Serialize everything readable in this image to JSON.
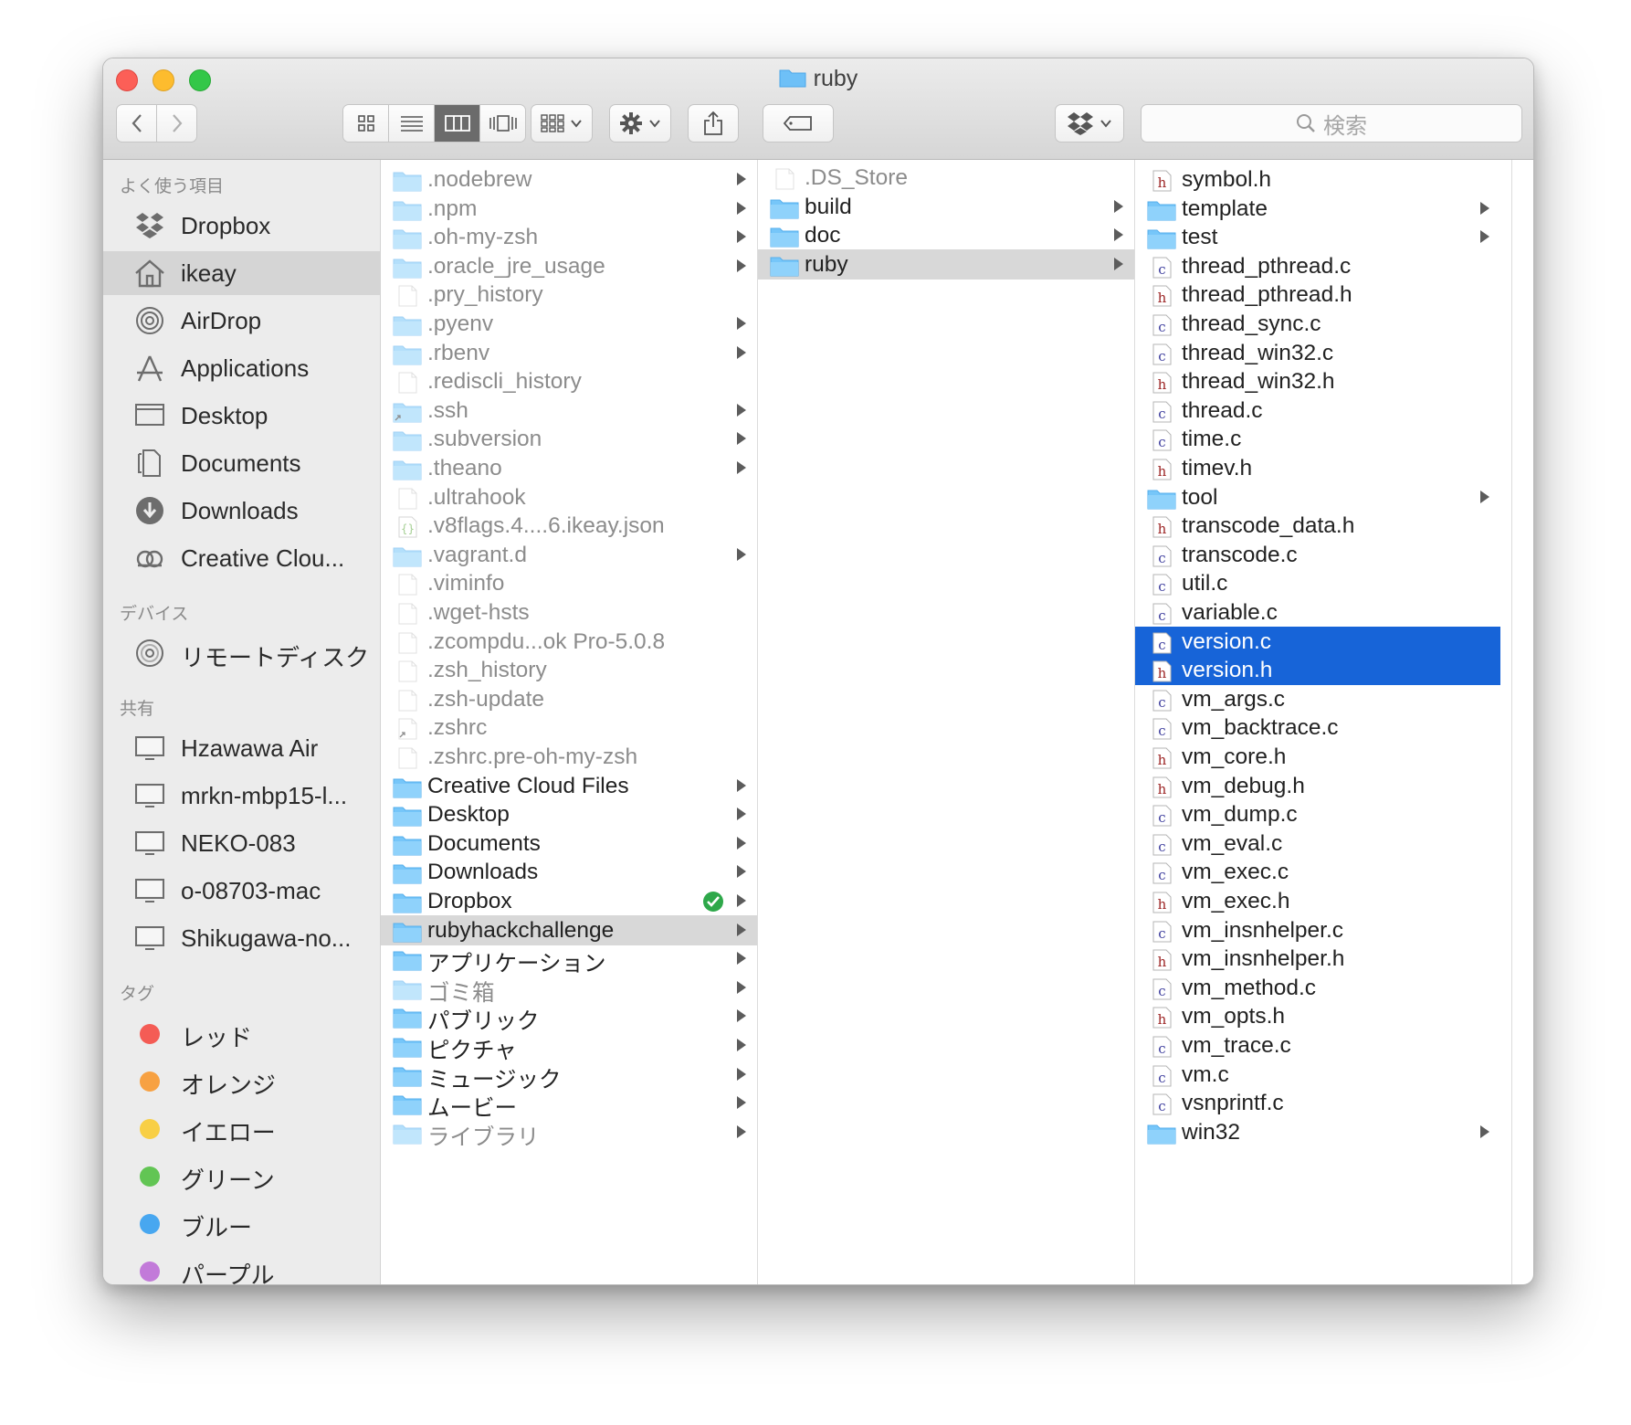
{
  "window": {
    "title": "ruby"
  },
  "toolbar": {
    "search_placeholder": "検索"
  },
  "colors": {
    "selection_blue": "#1764d8",
    "folder_blue": "#6ec0f7",
    "sidebar_bg": "#ececec"
  },
  "sidebar": {
    "sections": [
      {
        "header": "よく使う項目",
        "items": [
          {
            "label": "Dropbox",
            "icon": "dropbox-icon"
          },
          {
            "label": "ikeay",
            "icon": "home-icon",
            "selected": true
          },
          {
            "label": "AirDrop",
            "icon": "airdrop-icon"
          },
          {
            "label": "Applications",
            "icon": "applications-icon"
          },
          {
            "label": "Desktop",
            "icon": "desktop-icon"
          },
          {
            "label": "Documents",
            "icon": "documents-icon"
          },
          {
            "label": "Downloads",
            "icon": "downloads-icon"
          },
          {
            "label": "Creative Clou...",
            "icon": "creative-cloud-icon"
          }
        ]
      },
      {
        "header": "デバイス",
        "items": [
          {
            "label": "リモートディスク",
            "icon": "remote-disc-icon"
          }
        ]
      },
      {
        "header": "共有",
        "items": [
          {
            "label": "Hzawawa Air",
            "icon": "computer-icon"
          },
          {
            "label": "mrkn-mbp15-l...",
            "icon": "computer-icon"
          },
          {
            "label": "NEKO-083",
            "icon": "computer-icon"
          },
          {
            "label": "o-08703-mac",
            "icon": "computer-icon"
          },
          {
            "label": "Shikugawa-no...",
            "icon": "computer-icon"
          }
        ]
      },
      {
        "header": "タグ",
        "items": [
          {
            "label": "レッド",
            "color": "#f45c55"
          },
          {
            "label": "オレンジ",
            "color": "#f7a142"
          },
          {
            "label": "イエロー",
            "color": "#f8cf45"
          },
          {
            "label": "グリーン",
            "color": "#62c554"
          },
          {
            "label": "ブルー",
            "color": "#48a7f0"
          },
          {
            "label": "パープル",
            "color": "#c27ad9"
          }
        ]
      }
    ]
  },
  "columns": [
    {
      "items": [
        {
          "name": ".nodebrew",
          "kind": "folder",
          "dim": true,
          "arrow": true
        },
        {
          "name": ".npm",
          "kind": "folder",
          "dim": true,
          "arrow": true
        },
        {
          "name": ".oh-my-zsh",
          "kind": "folder",
          "dim": true,
          "arrow": true
        },
        {
          "name": ".oracle_jre_usage",
          "kind": "folder",
          "dim": true,
          "arrow": true
        },
        {
          "name": ".pry_history",
          "kind": "file",
          "dim": true
        },
        {
          "name": ".pyenv",
          "kind": "folder",
          "dim": true,
          "arrow": true
        },
        {
          "name": ".rbenv",
          "kind": "folder",
          "dim": true,
          "arrow": true
        },
        {
          "name": ".rediscli_history",
          "kind": "file",
          "dim": true
        },
        {
          "name": ".ssh",
          "kind": "alias-folder",
          "dim": true,
          "arrow": true
        },
        {
          "name": ".subversion",
          "kind": "folder",
          "dim": true,
          "arrow": true
        },
        {
          "name": ".theano",
          "kind": "folder",
          "dim": true,
          "arrow": true
        },
        {
          "name": ".ultrahook",
          "kind": "file",
          "dim": true
        },
        {
          "name": ".v8flags.4....6.ikeay.json",
          "kind": "json",
          "dim": true
        },
        {
          "name": ".vagrant.d",
          "kind": "folder",
          "dim": true,
          "arrow": true
        },
        {
          "name": ".viminfo",
          "kind": "file",
          "dim": true
        },
        {
          "name": ".wget-hsts",
          "kind": "file",
          "dim": true
        },
        {
          "name": ".zcompdu...ok Pro-5.0.8",
          "kind": "file",
          "dim": true
        },
        {
          "name": ".zsh_history",
          "kind": "file",
          "dim": true
        },
        {
          "name": ".zsh-update",
          "kind": "file",
          "dim": true
        },
        {
          "name": ".zshrc",
          "kind": "alias-file",
          "dim": true
        },
        {
          "name": ".zshrc.pre-oh-my-zsh",
          "kind": "file",
          "dim": true
        },
        {
          "name": "Creative Cloud Files",
          "kind": "folder",
          "arrow": true
        },
        {
          "name": "Desktop",
          "kind": "folder",
          "arrow": true
        },
        {
          "name": "Documents",
          "kind": "folder",
          "arrow": true
        },
        {
          "name": "Downloads",
          "kind": "folder",
          "arrow": true
        },
        {
          "name": "Dropbox",
          "kind": "folder",
          "arrow": true,
          "badge": "synced-check-icon"
        },
        {
          "name": "rubyhackchallenge",
          "kind": "folder",
          "arrow": true,
          "selected": "gray"
        },
        {
          "name": "アプリケーション",
          "kind": "folder",
          "arrow": true
        },
        {
          "name": "ゴミ箱",
          "kind": "folder",
          "dim": true,
          "arrow": true
        },
        {
          "name": "パブリック",
          "kind": "folder",
          "arrow": true
        },
        {
          "name": "ピクチャ",
          "kind": "folder",
          "arrow": true
        },
        {
          "name": "ミュージック",
          "kind": "folder",
          "arrow": true
        },
        {
          "name": "ムービー",
          "kind": "folder",
          "arrow": true
        },
        {
          "name": "ライブラリ",
          "kind": "folder",
          "dim": true,
          "arrow": true
        }
      ]
    },
    {
      "items": [
        {
          "name": ".DS_Store",
          "kind": "file",
          "dim": true
        },
        {
          "name": "build",
          "kind": "folder",
          "arrow": true
        },
        {
          "name": "doc",
          "kind": "folder",
          "arrow": true
        },
        {
          "name": "ruby",
          "kind": "folder",
          "arrow": true,
          "selected": "gray"
        }
      ]
    },
    {
      "items": [
        {
          "name": "symbol.h",
          "kind": "h"
        },
        {
          "name": "template",
          "kind": "folder",
          "arrow": true
        },
        {
          "name": "test",
          "kind": "folder",
          "arrow": true
        },
        {
          "name": "thread_pthread.c",
          "kind": "c"
        },
        {
          "name": "thread_pthread.h",
          "kind": "h"
        },
        {
          "name": "thread_sync.c",
          "kind": "c"
        },
        {
          "name": "thread_win32.c",
          "kind": "c"
        },
        {
          "name": "thread_win32.h",
          "kind": "h"
        },
        {
          "name": "thread.c",
          "kind": "c"
        },
        {
          "name": "time.c",
          "kind": "c"
        },
        {
          "name": "timev.h",
          "kind": "h"
        },
        {
          "name": "tool",
          "kind": "folder",
          "arrow": true
        },
        {
          "name": "transcode_data.h",
          "kind": "h"
        },
        {
          "name": "transcode.c",
          "kind": "c"
        },
        {
          "name": "util.c",
          "kind": "c"
        },
        {
          "name": "variable.c",
          "kind": "c"
        },
        {
          "name": "version.c",
          "kind": "c",
          "selected": "blue"
        },
        {
          "name": "version.h",
          "kind": "h",
          "selected": "blue"
        },
        {
          "name": "vm_args.c",
          "kind": "c"
        },
        {
          "name": "vm_backtrace.c",
          "kind": "c"
        },
        {
          "name": "vm_core.h",
          "kind": "h"
        },
        {
          "name": "vm_debug.h",
          "kind": "h"
        },
        {
          "name": "vm_dump.c",
          "kind": "c"
        },
        {
          "name": "vm_eval.c",
          "kind": "c"
        },
        {
          "name": "vm_exec.c",
          "kind": "c"
        },
        {
          "name": "vm_exec.h",
          "kind": "h"
        },
        {
          "name": "vm_insnhelper.c",
          "kind": "c"
        },
        {
          "name": "vm_insnhelper.h",
          "kind": "h"
        },
        {
          "name": "vm_method.c",
          "kind": "c"
        },
        {
          "name": "vm_opts.h",
          "kind": "h"
        },
        {
          "name": "vm_trace.c",
          "kind": "c"
        },
        {
          "name": "vm.c",
          "kind": "c"
        },
        {
          "name": "vsnprintf.c",
          "kind": "c"
        },
        {
          "name": "win32",
          "kind": "folder",
          "arrow": true
        }
      ]
    }
  ]
}
